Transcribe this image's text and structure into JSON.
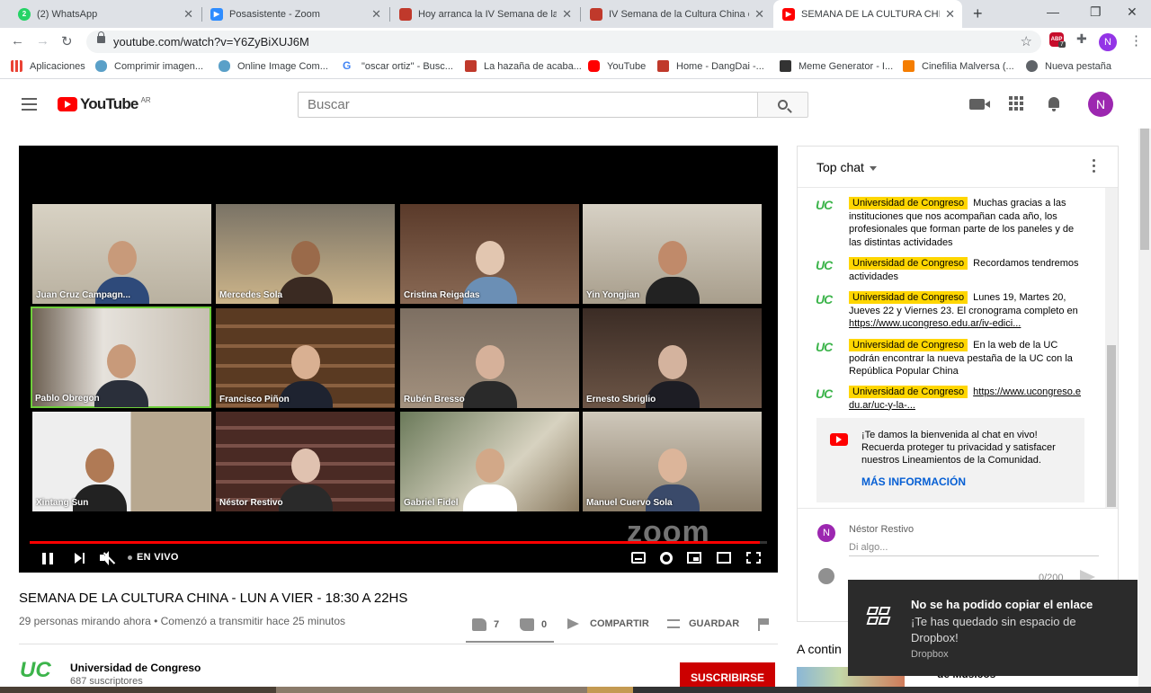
{
  "browser": {
    "tabs": [
      {
        "title": "(2) WhatsApp",
        "icon": "whatsapp-icon",
        "color": "#25d366"
      },
      {
        "title": "Posasistente - Zoom",
        "icon": "zoom-icon",
        "color": "#2d8cff"
      },
      {
        "title": "Hoy arranca la IV Semana de la C",
        "icon": "news-icon",
        "color": "#c0392b"
      },
      {
        "title": "IV Semana de la Cultura China en",
        "icon": "news-icon",
        "color": "#c0392b"
      },
      {
        "title": "SEMANA DE LA CULTURA CHINA",
        "icon": "youtube-icon",
        "color": "#ff0000"
      }
    ],
    "url": "youtube.com/watch?v=Y6ZyBiXUJ6M",
    "profile_initial": "N",
    "abp_badge": "7",
    "bookmarks": [
      {
        "label": "Aplicaciones",
        "icon": "apps-icon"
      },
      {
        "label": "Comprimir imagen...",
        "icon": "cloud-icon"
      },
      {
        "label": "Online Image Com...",
        "icon": "cloud-icon"
      },
      {
        "label": "\"oscar ortiz\" - Busc...",
        "icon": "google-icon"
      },
      {
        "label": "La hazaña de acaba...",
        "icon": "news-icon"
      },
      {
        "label": "YouTube",
        "icon": "youtube-icon"
      },
      {
        "label": "Home - DangDai -...",
        "icon": "news-icon"
      },
      {
        "label": "Meme Generator - I...",
        "icon": "meme-icon"
      },
      {
        "label": "Cinefilia Malversa (...",
        "icon": "blogger-icon"
      },
      {
        "label": "Nueva pestaña",
        "icon": "globe-icon"
      }
    ]
  },
  "youtube": {
    "logo_text": "YouTube",
    "country_code": "AR",
    "search_placeholder": "Buscar",
    "avatar_initial": "N"
  },
  "video": {
    "participants": [
      "Juan Cruz Campagn...",
      "Mercedes Sola",
      "Cristina Reigadas",
      "Yin Yongjian",
      "Pablo Obregon",
      "Francisco Piñon",
      "Rubén Bresso",
      "Ernesto Sbriglio",
      "Xintang Sun",
      "Néstor Restivo",
      "Gabriel Fidel",
      "Manuel Cuervo Sola"
    ],
    "watermark": "zoom",
    "live_label": "EN VIVO",
    "progress": 0.99,
    "title": "SEMANA DE LA CULTURA CHINA - LUN A VIER - 18:30 A 22HS",
    "meta": "29 personas mirando ahora • Comenzó a transmitir hace 25 minutos",
    "likes": "7",
    "dislikes": "0",
    "share_label": "COMPARTIR",
    "save_label": "GUARDAR"
  },
  "channel": {
    "logo_text": "UC",
    "name": "Universidad de Congreso",
    "subscribers": "687 suscriptores",
    "subscribe_label": "SUSCRIBIRSE"
  },
  "chat": {
    "header": "Top chat",
    "messages": [
      {
        "author": "Universidad de Congreso",
        "text": "Muchas gracias a las instituciones que nos acompañan cada año, los profesionales que forman parte de los paneles y de las distintas actividades",
        "link": ""
      },
      {
        "author": "Universidad de Congreso",
        "text": "Recordamos tendremos actividades",
        "link": ""
      },
      {
        "author": "Universidad de Congreso",
        "text": "Lunes 19, Martes 20, Jueves 22 y Viernes 23. El cronograma completo en ",
        "link": "https://www.ucongreso.edu.ar/iv-edici..."
      },
      {
        "author": "Universidad de Congreso",
        "text": "En la web de la UC podrán encontrar la nueva pestaña de la UC con la República Popular China",
        "link": ""
      },
      {
        "author": "Universidad de Congreso",
        "text": "",
        "link": "https://www.ucongreso.edu.ar/uc-y-la-..."
      }
    ],
    "welcome_text": "¡Te damos la bienvenida al chat en vivo! Recuerda proteger tu privacidad y satisfacer nuestros Lineamientos de la Comunidad.",
    "welcome_more": "MÁS INFORMACIÓN",
    "composer_avatar": "N",
    "composer_user": "Néstor Restivo",
    "composer_placeholder": "Di algo...",
    "composer_counter": "0/200"
  },
  "sidebar": {
    "continue_label": "A contin",
    "suggestion_title": "de Músicos"
  },
  "toast": {
    "title": "No se ha podido copiar el enlace",
    "body": "¡Te has quedado sin espacio de Dropbox!",
    "app": "Dropbox"
  }
}
